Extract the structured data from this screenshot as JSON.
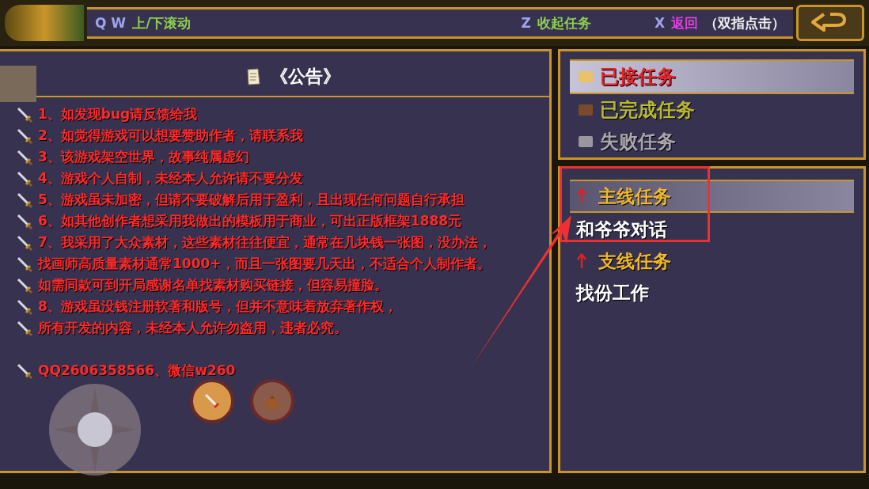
{
  "top_bar": {
    "hints": [
      {
        "keys": [
          "Q",
          "W"
        ],
        "label": "上/下滚动",
        "color": "#8fd14f"
      },
      {
        "keys": [
          "Z"
        ],
        "label": "收起任务",
        "color": "#8fd14f"
      },
      {
        "keys": [
          "X"
        ],
        "label": "返回",
        "color": "#e040e0",
        "note": "（双指点击）"
      }
    ]
  },
  "notice": {
    "title": "《公告》",
    "lines": [
      "1、如发现bug请反馈给我",
      "2、如觉得游戏可以想要赞助作者，请联系我",
      "3、该游戏架空世界，故事纯属虚幻",
      "4、游戏个人自制，未经本人允许请不要分发",
      "5、游戏虽未加密，但请不要破解后用于盈利，且出现任何问题自行承担",
      "6、如其他创作者想采用我做出的模板用于商业，可出正版框架1888元",
      "7、我采用了大众素材，这些素材往往便宜，通常在几块钱一张图，没办法，",
      "找画师高质量素材通常1000+，而且一张图要几天出，不适合个人制作者。",
      "如需同款可到开局感谢名单找素材购买链接，但容易撞脸。",
      "8、游戏虽没钱注册软著和版号，但并不意味着放弃著作权，",
      "所有开发的内容，未经本人允许勿盗用，违者必究。"
    ],
    "contact": "QQ2606358566、微信w260"
  },
  "task_tabs": [
    {
      "label": "已接任务",
      "selected": true,
      "color": "#e8242a"
    },
    {
      "label": "已完成任务",
      "selected": false,
      "color": "#b8b832"
    },
    {
      "label": "失败任务",
      "selected": false,
      "color": "#a9a6ae"
    }
  ],
  "task_groups": [
    {
      "title": "主线任务",
      "selected": true,
      "children": [
        {
          "label": "和爷爷对话"
        }
      ]
    },
    {
      "title": "支线任务",
      "selected": false,
      "children": [
        {
          "label": "找份工作"
        }
      ]
    }
  ]
}
